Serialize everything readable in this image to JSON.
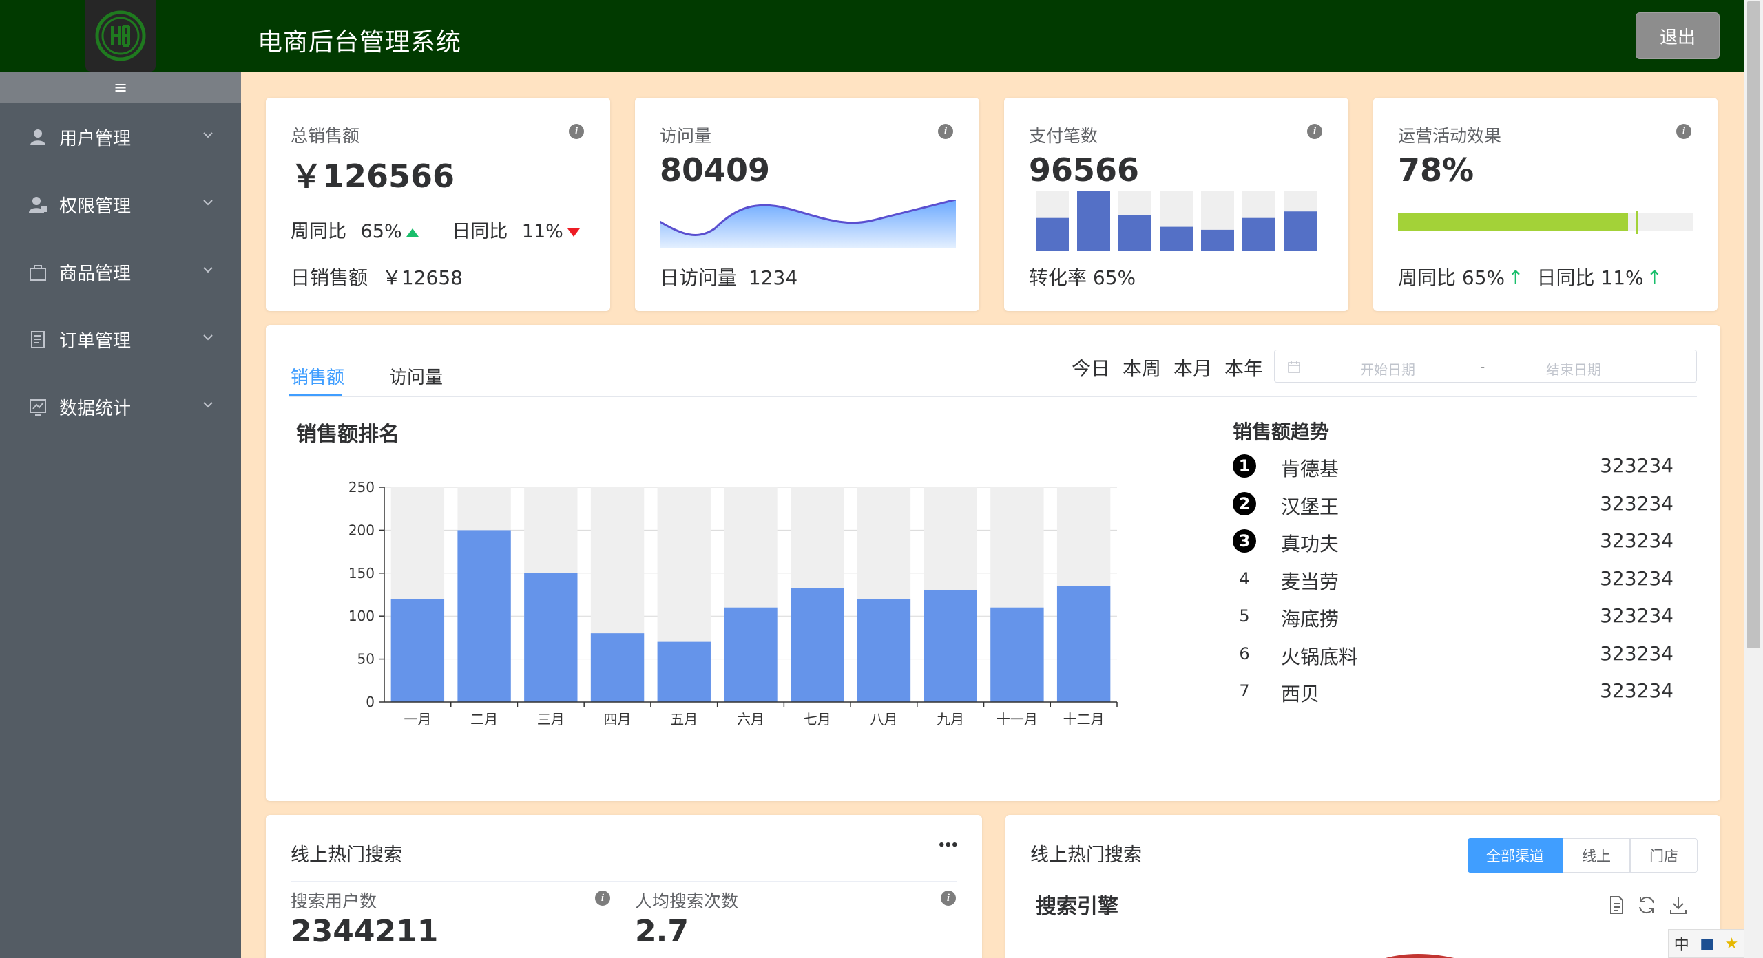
{
  "header": {
    "app_title": "电商后台管理系统",
    "logout_label": "退出"
  },
  "sidebar": {
    "toggle_glyph": "≡",
    "items": [
      {
        "label": "用户管理",
        "icon": "user-icon"
      },
      {
        "label": "权限管理",
        "icon": "lock-user-icon"
      },
      {
        "label": "商品管理",
        "icon": "bag-icon"
      },
      {
        "label": "订单管理",
        "icon": "document-icon"
      },
      {
        "label": "数据统计",
        "icon": "chart-icon"
      }
    ]
  },
  "stats": {
    "sales": {
      "label": "总销售额",
      "value": "￥126566",
      "week_label": "周同比",
      "week_value": "65%",
      "day_label": "日同比",
      "day_value": "11%",
      "footer_label": "日销售额",
      "footer_value": "￥12658"
    },
    "visits": {
      "label": "访问量",
      "value": "80409",
      "footer_label": "日访问量",
      "footer_value": "1234"
    },
    "payments": {
      "label": "支付笔数",
      "value": "96566",
      "footer": "转化率 65%",
      "mini_bars": [
        0.55,
        1.0,
        0.6,
        0.4,
        0.35,
        0.55,
        0.66
      ]
    },
    "campaign": {
      "label": "运营活动效果",
      "value": "78%",
      "progress": 0.78,
      "footer_week": "周同比 65%",
      "footer_day": "日同比 11%"
    }
  },
  "main": {
    "tabs": [
      "销售额",
      "访问量"
    ],
    "periods": [
      "今日",
      "本周",
      "本月",
      "本年"
    ],
    "date_start_placeholder": "开始日期",
    "date_sep": "-",
    "date_end_placeholder": "结束日期",
    "chart_title": "销售额排名",
    "ranking_title": "销售额趋势",
    "ranking": [
      {
        "rank": "1",
        "name": "肯德基",
        "value": "323234"
      },
      {
        "rank": "2",
        "name": "汉堡王",
        "value": "323234"
      },
      {
        "rank": "3",
        "name": "真功夫",
        "value": "323234"
      },
      {
        "rank": "4",
        "name": "麦当劳",
        "value": "323234"
      },
      {
        "rank": "5",
        "name": "海底捞",
        "value": "323234"
      },
      {
        "rank": "6",
        "name": "火锅底料",
        "value": "323234"
      },
      {
        "rank": "7",
        "name": "西贝",
        "value": "323234"
      }
    ]
  },
  "chart_data": {
    "type": "bar",
    "categories": [
      "一月",
      "二月",
      "三月",
      "四月",
      "五月",
      "六月",
      "七月",
      "八月",
      "九月",
      "十一月",
      "十二月"
    ],
    "values": [
      120,
      200,
      150,
      80,
      70,
      110,
      133,
      120,
      130,
      110,
      135
    ],
    "background_max": 250,
    "ylim": [
      0,
      250
    ],
    "yticks": [
      0,
      50,
      100,
      150,
      200,
      250
    ],
    "bar_color": "#6594ea",
    "bg_bar_color": "#efefef"
  },
  "bottom_left": {
    "title": "线上热门搜索",
    "more_glyph": "•••",
    "metric1_label": "搜索用户数",
    "metric1_value": "2344211",
    "metric2_label": "人均搜索次数",
    "metric2_value": "2.7"
  },
  "bottom_right": {
    "title": "线上热门搜索",
    "channel_buttons": [
      "全部渠道",
      "线上",
      "门店"
    ],
    "subtitle": "搜索引擎"
  },
  "ime": {
    "label": "中"
  },
  "colors": {
    "header_bg": "#013a00",
    "sidebar_bg": "#545c64",
    "page_bg": "#ffe3c2",
    "accent": "#409eff",
    "progress": "#a3d238"
  }
}
